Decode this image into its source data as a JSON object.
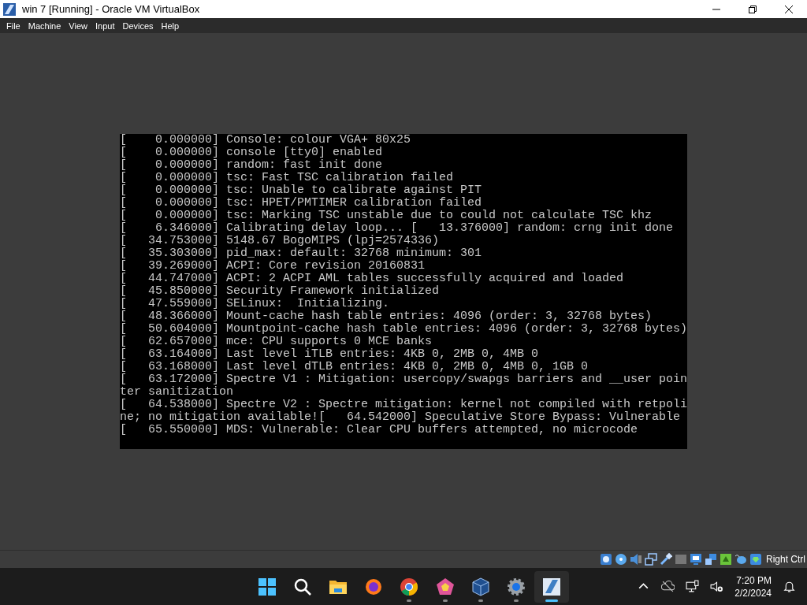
{
  "window": {
    "title": "win 7 [Running] - Oracle VM VirtualBox"
  },
  "menu": [
    "File",
    "Machine",
    "View",
    "Input",
    "Devices",
    "Help"
  ],
  "console": {
    "lines": [
      "[    0.000000] Console: colour VGA+ 80x25",
      "[    0.000000] console [tty0] enabled",
      "[    0.000000] random: fast init done",
      "[    0.000000] tsc: Fast TSC calibration failed",
      "[    0.000000] tsc: Unable to calibrate against PIT",
      "[    0.000000] tsc: HPET/PMTIMER calibration failed",
      "[    0.000000] tsc: Marking TSC unstable due to could not calculate TSC khz",
      "[    6.346000] Calibrating delay loop... [   13.376000] random: crng init done",
      "[   34.753000] 5148.67 BogoMIPS (lpj=2574336)",
      "[   35.303000] pid_max: default: 32768 minimum: 301",
      "[   39.269000] ACPI: Core revision 20160831",
      "[   44.747000] ACPI: 2 ACPI AML tables successfully acquired and loaded",
      "[   45.850000] Security Framework initialized",
      "[   47.559000] SELinux:  Initializing.",
      "[   48.366000] Mount-cache hash table entries: 4096 (order: 3, 32768 bytes)",
      "[   50.604000] Mountpoint-cache hash table entries: 4096 (order: 3, 32768 bytes)",
      "[   62.657000] mce: CPU supports 0 MCE banks",
      "[   63.164000] Last level iTLB entries: 4KB 0, 2MB 0, 4MB 0",
      "[   63.168000] Last level dTLB entries: 4KB 0, 2MB 0, 4MB 0, 1GB 0",
      "[   63.172000] Spectre V1 : Mitigation: usercopy/swapgs barriers and __user poin",
      "ter sanitization",
      "[   64.538000] Spectre V2 : Spectre mitigation: kernel not compiled with retpoli",
      "ne; no mitigation available![   64.542000] Speculative Store Bypass: Vulnerable",
      "[   65.550000] MDS: Vulnerable: Clear CPU buffers attempted, no microcode"
    ]
  },
  "status_bar": {
    "host_key": "Right Ctrl"
  },
  "taskbar": {
    "apps": [
      {
        "kind": "start",
        "running": false,
        "selected": false
      },
      {
        "kind": "search",
        "running": false,
        "selected": false
      },
      {
        "kind": "explorer",
        "running": false,
        "selected": false
      },
      {
        "kind": "firefox",
        "running": false,
        "selected": false
      },
      {
        "kind": "chrome",
        "running": true,
        "selected": false
      },
      {
        "kind": "pentagon",
        "running": true,
        "selected": false
      },
      {
        "kind": "virtualbox",
        "running": true,
        "selected": false
      },
      {
        "kind": "settings",
        "running": true,
        "selected": false
      },
      {
        "kind": "vm",
        "running": true,
        "selected": true
      }
    ],
    "time": "7:20 PM",
    "date": "2/2/2024"
  }
}
